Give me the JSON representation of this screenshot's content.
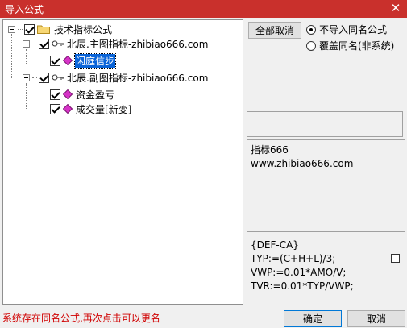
{
  "window": {
    "title": "导入公式",
    "close_glyph": "✕"
  },
  "tree": {
    "root": {
      "label": "技术指标公式",
      "checked": true
    },
    "groups": [
      {
        "label": "北辰.主图指标-zhibiao666.com",
        "checked": true,
        "items": [
          {
            "label": "闲庭信步",
            "checked": true,
            "selected": true
          }
        ]
      },
      {
        "label": "北辰.副图指标-zhibiao666.com",
        "checked": true,
        "items": [
          {
            "label": "资金盈亏",
            "checked": true
          },
          {
            "label": "成交量[新变]",
            "checked": true
          }
        ]
      }
    ]
  },
  "options": {
    "cancel_all_label": "全部取消",
    "radio_no_import": "不导入同名公式",
    "radio_overwrite": "覆盖同名(非系统)",
    "selected": "no_import"
  },
  "info_panel": {
    "text": "指标666\nwww.zhibiao666.com"
  },
  "code_panel": {
    "text": "{DEF-CA}\nTYP:=(C+H+L)/3;\nVWP:=0.01*AMO/V;\nTVR:=0.01*TYP/VWP;"
  },
  "footer": {
    "status": "系统存在同名公式,再次点击可以更名",
    "ok_label": "确定",
    "cancel_label": "取消"
  },
  "colors": {
    "titlebar": "#c9302c",
    "selection": "#0a64d8",
    "status_text": "#d00000"
  }
}
